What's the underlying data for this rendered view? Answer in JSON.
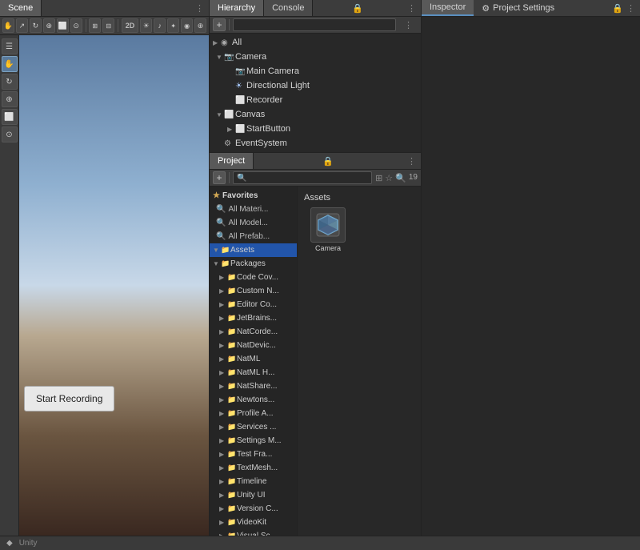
{
  "topBar": {},
  "scene": {
    "tabLabel": "Scene",
    "toolbar": {
      "buttons": [
        "✋",
        "↗",
        "⊕",
        "↻",
        "⬜",
        "🔲"
      ],
      "twoDLabel": "2D",
      "dotsLabel": "⋮"
    },
    "tools": [
      {
        "icon": "☰",
        "name": "menu"
      },
      {
        "icon": "✋",
        "name": "hand"
      },
      {
        "icon": "↻",
        "name": "rotate"
      },
      {
        "icon": "⊕",
        "name": "move"
      },
      {
        "icon": "⬜",
        "name": "rect"
      },
      {
        "icon": "⊙",
        "name": "transform"
      }
    ],
    "startRecordingLabel": "Start Recording"
  },
  "hierarchy": {
    "tabLabel": "Hierarchy",
    "consoleTablabel": "Console",
    "dotsLabel": "⋮",
    "lockIcon": "🔒",
    "searchPlaceholder": "",
    "items": [
      {
        "label": "All",
        "indent": 0,
        "arrow": "",
        "icon": ""
      },
      {
        "label": "Camera",
        "indent": 1,
        "arrow": "▼",
        "icon": "📷",
        "iconType": "blue"
      },
      {
        "label": "Main Camera",
        "indent": 2,
        "arrow": "",
        "icon": "📷",
        "iconType": "blue"
      },
      {
        "label": "Directional Light",
        "indent": 2,
        "arrow": "",
        "icon": "☀",
        "iconType": "blue"
      },
      {
        "label": "Recorder",
        "indent": 2,
        "arrow": "",
        "icon": "⬜",
        "iconType": "gray"
      },
      {
        "label": "Canvas",
        "indent": 1,
        "arrow": "▼",
        "icon": "⬜",
        "iconType": "gray"
      },
      {
        "label": "StartButton",
        "indent": 2,
        "arrow": "▶",
        "icon": "⬜",
        "iconType": "gray"
      },
      {
        "label": "EventSystem",
        "indent": 1,
        "arrow": "",
        "icon": "⚙",
        "iconType": "gray"
      }
    ]
  },
  "project": {
    "tabLabel": "Project",
    "dotsLabel": "⋮",
    "lockIcon": "🔒",
    "badgeCount": "19",
    "searchPlaceholder": "🔍",
    "assetsLabel": "Assets",
    "favorites": {
      "label": "Favorites",
      "items": [
        {
          "label": "All Materials"
        },
        {
          "label": "All Models"
        },
        {
          "label": "All Prefabs"
        }
      ]
    },
    "tree": {
      "items": [
        {
          "label": "Assets",
          "indent": 0,
          "arrow": "▼"
        },
        {
          "label": "Packages",
          "indent": 0,
          "arrow": "▼"
        },
        {
          "label": "Code Cov...",
          "indent": 1,
          "arrow": "▶"
        },
        {
          "label": "Custom N...",
          "indent": 1,
          "arrow": "▶"
        },
        {
          "label": "Editor Co...",
          "indent": 1,
          "arrow": "▶"
        },
        {
          "label": "JetBrains...",
          "indent": 1,
          "arrow": "▶"
        },
        {
          "label": "NatCorde...",
          "indent": 1,
          "arrow": "▶"
        },
        {
          "label": "NatDevic...",
          "indent": 1,
          "arrow": "▶"
        },
        {
          "label": "NatML",
          "indent": 1,
          "arrow": "▶"
        },
        {
          "label": "NatML H...",
          "indent": 1,
          "arrow": "▶"
        },
        {
          "label": "NatShare...",
          "indent": 1,
          "arrow": "▶"
        },
        {
          "label": "Newtons...",
          "indent": 1,
          "arrow": "▶"
        },
        {
          "label": "Profile A...",
          "indent": 1,
          "arrow": "▶"
        },
        {
          "label": "Services ...",
          "indent": 1,
          "arrow": "▶"
        },
        {
          "label": "Settings M...",
          "indent": 1,
          "arrow": "▶"
        },
        {
          "label": "Test Fra...",
          "indent": 1,
          "arrow": "▶"
        },
        {
          "label": "TextMesh...",
          "indent": 1,
          "arrow": "▶"
        },
        {
          "label": "Timeline",
          "indent": 1,
          "arrow": "▶"
        },
        {
          "label": "Unity UI",
          "indent": 1,
          "arrow": "▶"
        },
        {
          "label": "Version C...",
          "indent": 1,
          "arrow": "▶"
        },
        {
          "label": "VideoKit",
          "indent": 1,
          "arrow": "▶"
        },
        {
          "label": "Visual Sc...",
          "indent": 1,
          "arrow": "▶"
        }
      ]
    },
    "assetsGrid": [
      {
        "label": "Camera",
        "icon": "📷"
      }
    ]
  },
  "inspector": {
    "tabLabel": "Inspector",
    "projectSettingsLabel": "Project Settings",
    "lockIcon": "🔒",
    "dotsLabel": "⋮"
  },
  "bottomBar": {
    "label": "Unity"
  }
}
